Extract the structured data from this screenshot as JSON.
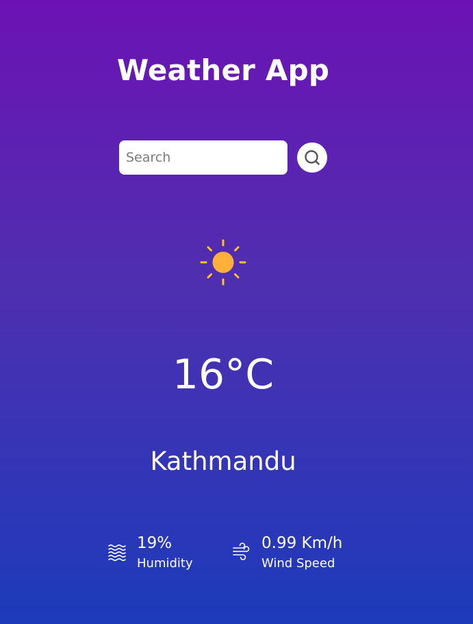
{
  "app": {
    "title": "Weather App"
  },
  "search": {
    "placeholder": "Search",
    "value": "",
    "button_icon": "search-icon"
  },
  "weather": {
    "icon": "sun-icon",
    "temperature": "16°C",
    "city": "Kathmandu"
  },
  "details": {
    "humidity": {
      "icon": "humidity-icon",
      "value": "19%",
      "label": "Humidity"
    },
    "wind": {
      "icon": "wind-icon",
      "value": "0.99 Km/h",
      "label": "Wind Speed"
    }
  },
  "colors": {
    "gradient_top": "#6c12b4",
    "gradient_bottom": "#1c3bbb",
    "sun": "#ffb03a",
    "sun_rays": "#ffc61a"
  }
}
